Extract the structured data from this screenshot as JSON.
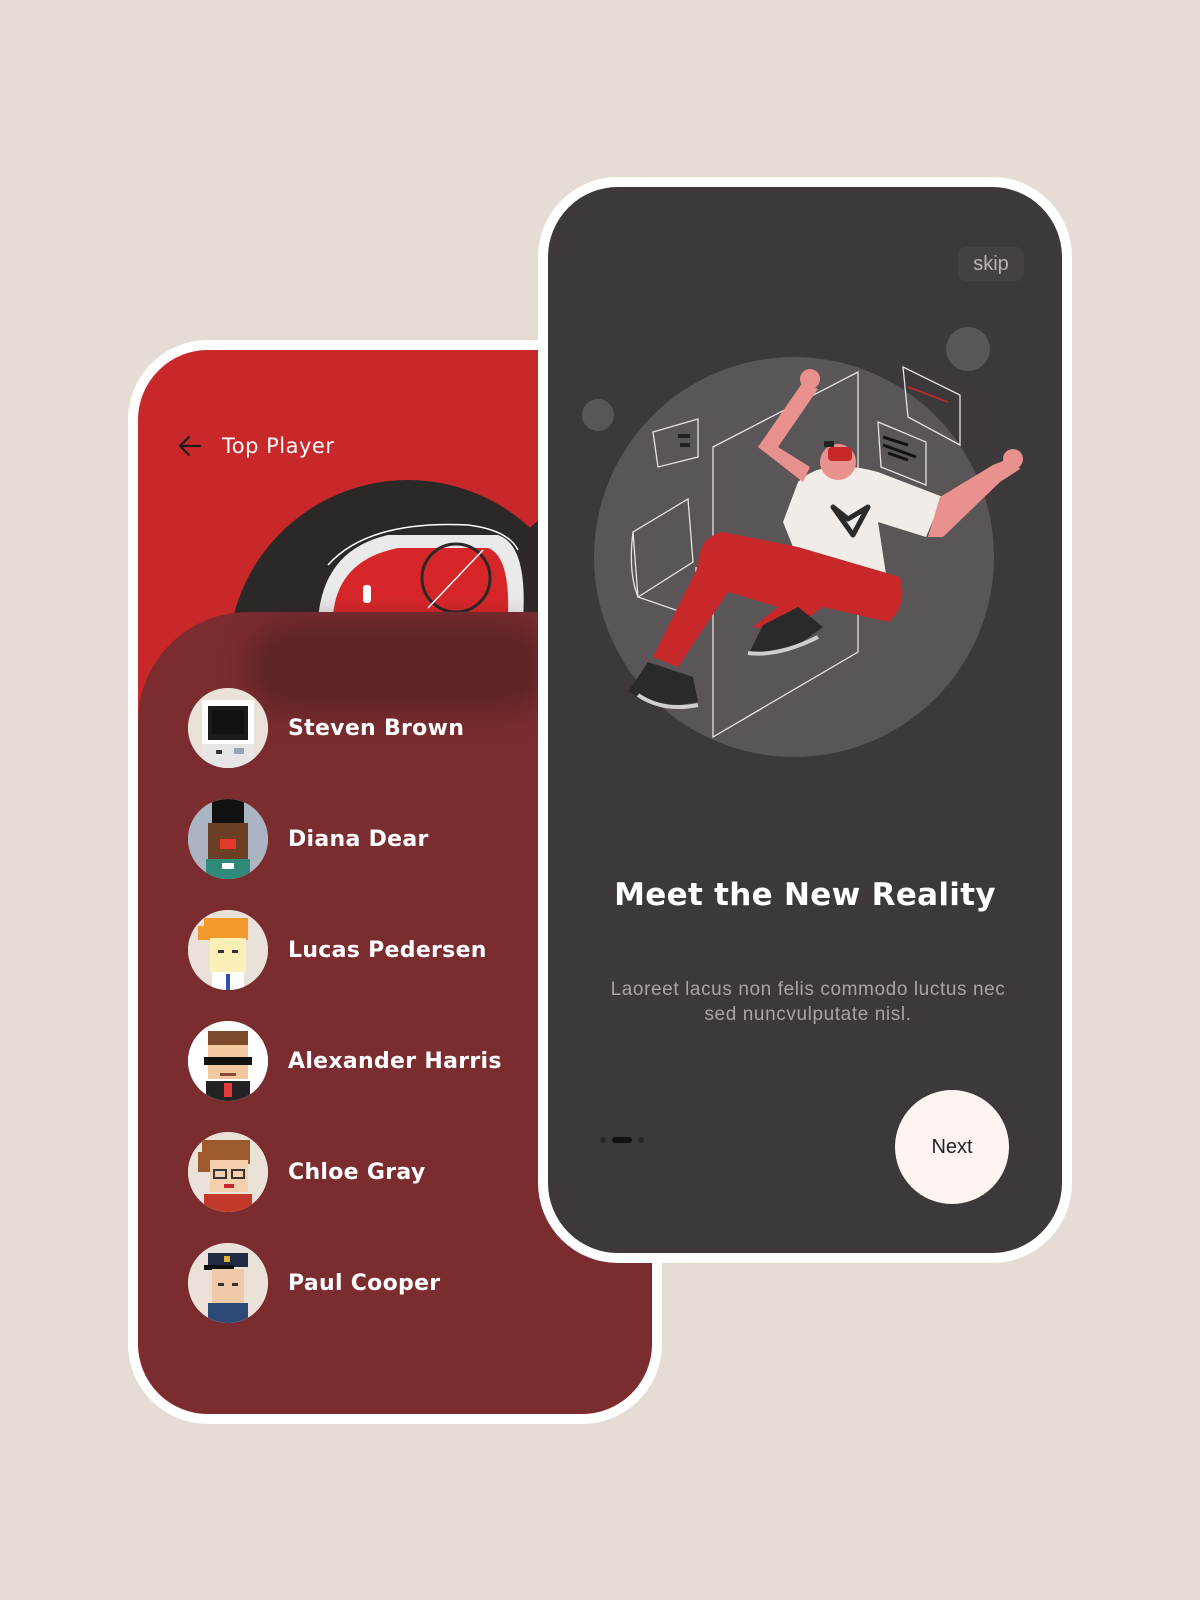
{
  "top_player": {
    "title": "Top Player",
    "players": [
      {
        "name": "Steven Brown"
      },
      {
        "name": "Diana Dear"
      },
      {
        "name": "Lucas Pedersen"
      },
      {
        "name": "Alexander Harris"
      },
      {
        "name": "Chloe Gray"
      },
      {
        "name": "Paul Cooper"
      }
    ]
  },
  "onboarding": {
    "skip_label": "skip",
    "title": "Meet the New Reality",
    "description": "Laoreet lacus non felis commodo luctus nec sed nuncvulputate nisl.",
    "next_label": "Next",
    "page_indicator": {
      "total": 3,
      "active": 2
    }
  },
  "colors": {
    "background": "#e5ddd3",
    "accent_red": "#c8282a",
    "sheet_maroon": "#7b2c2f",
    "dark_panel": "#3d393a"
  },
  "icons": {
    "back": "arrow-left-icon"
  }
}
